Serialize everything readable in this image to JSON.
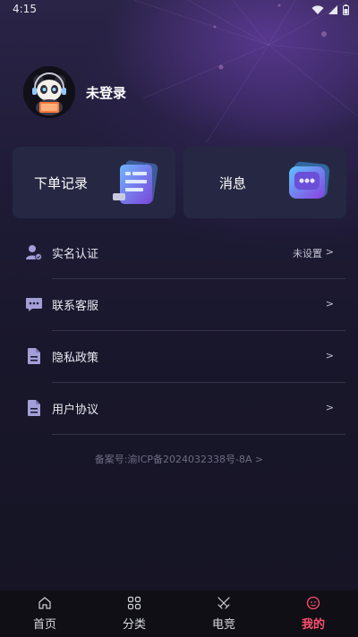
{
  "status_bar": {
    "time": "4:15"
  },
  "profile": {
    "name": "未登录"
  },
  "cards": [
    {
      "label": "下单记录"
    },
    {
      "label": "消息"
    }
  ],
  "menu": [
    {
      "label": "实名认证",
      "value": "未设置",
      "chevron": ">"
    },
    {
      "label": "联系客服",
      "value": "",
      "chevron": ">"
    },
    {
      "label": "隐私政策",
      "value": "",
      "chevron": ">"
    },
    {
      "label": "用户协议",
      "value": "",
      "chevron": ">"
    }
  ],
  "footer": {
    "icp": "备案号:渝ICP备2024032338号-8A >"
  },
  "tabs": [
    {
      "label": "首页",
      "icon": "home-icon",
      "active": false
    },
    {
      "label": "分类",
      "icon": "grid-icon",
      "active": false
    },
    {
      "label": "电竞",
      "icon": "swords-icon",
      "active": false
    },
    {
      "label": "我的",
      "icon": "smile-icon",
      "active": true
    }
  ],
  "colors": {
    "background": "#171628",
    "card": "#262843",
    "active_tab": "#ff4f6e",
    "menu_icon": "#a49ed8"
  }
}
